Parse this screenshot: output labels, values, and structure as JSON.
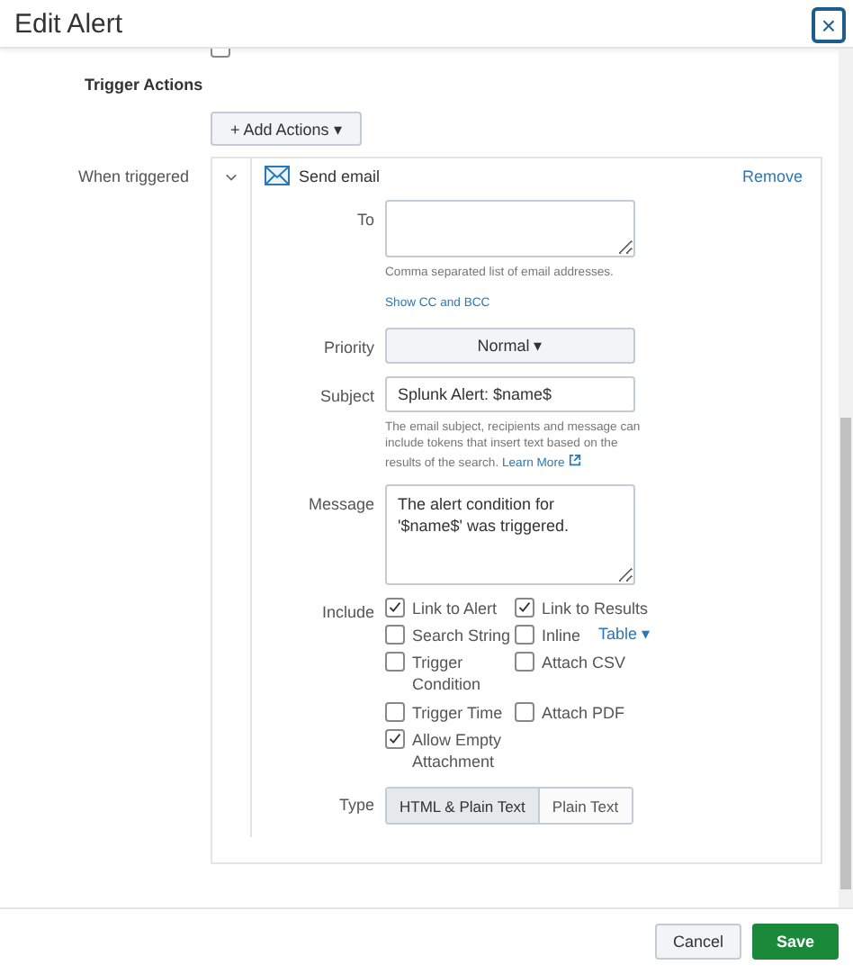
{
  "window": {
    "title": "Edit Alert",
    "close": "×"
  },
  "throttle": {
    "checked": false
  },
  "trigger_actions": {
    "heading": "Trigger Actions",
    "add_button": "+ Add Actions ▾"
  },
  "when_triggered": {
    "label": "When triggered",
    "expanded": true,
    "action": {
      "title": "Send email",
      "remove": "Remove",
      "to": {
        "label": "To",
        "help": "Comma separated list of email addresses.",
        "link": "Show CC and BCC"
      },
      "priority": {
        "label": "Priority",
        "value": "Normal ▾"
      },
      "subject": {
        "label": "Subject",
        "value": "Splunk Alert: $name$",
        "help": "The email subject, recipients and message can include tokens that insert text based on the results of the search.",
        "link": "Learn More"
      },
      "message": {
        "label": "Message",
        "value": "The alert condition for '$name$' was triggered."
      },
      "include": {
        "label": "Include",
        "options": [
          {
            "label": "Link to Alert",
            "checked": true
          },
          {
            "label": "Link to Results",
            "checked": true
          },
          {
            "label": "Search String",
            "checked": false
          },
          {
            "label": "Inline",
            "checked": false,
            "dropdown": "Table ▾"
          },
          {
            "label": "Trigger Condition",
            "checked": false
          },
          {
            "label": "Attach CSV",
            "checked": false
          },
          {
            "label": "Trigger Time",
            "checked": false
          },
          {
            "label": "Attach PDF",
            "checked": false
          },
          {
            "label": "Allow Empty Attachment",
            "checked": true
          }
        ]
      },
      "type": {
        "label": "Type",
        "options": [
          {
            "label": "HTML & Plain Text",
            "selected": true
          },
          {
            "label": "Plain Text",
            "selected": false
          }
        ]
      }
    }
  },
  "footer": {
    "cancel": "Cancel",
    "save": "Save"
  }
}
